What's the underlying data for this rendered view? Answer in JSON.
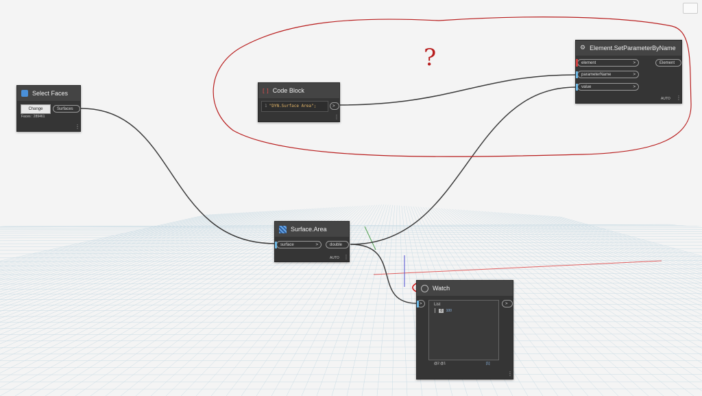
{
  "select_faces": {
    "title": "Select Faces",
    "change_label": "Change",
    "output_label": "Surfaces",
    "status": "Faces : 289461"
  },
  "code_block": {
    "title": "Code Block",
    "title_icon": "[ ]",
    "line_number": "1",
    "code": "\"DYN.Surface Area\";",
    "output_label": ">"
  },
  "set_param": {
    "title": "Element.SetParameterByName",
    "inputs": [
      "element",
      "parameterName",
      "value"
    ],
    "output_label": "Element",
    "lacing": "AUTO"
  },
  "surface_area": {
    "title": "Surface.Area",
    "input_label": "surface",
    "output_label": "double",
    "lacing": "AUTO"
  },
  "watch": {
    "title": "Watch",
    "list_label": "List",
    "item_index": "0",
    "item_value": "100",
    "footer_left": "@2 @1",
    "footer_right": "[1]",
    "output_label": ">"
  },
  "annotation": {
    "question_mark": "?"
  },
  "colors": {
    "node_bg": "#353535",
    "header_bg": "#444444",
    "wire": "#3a3a3a",
    "annotation_red": "#b81d1d",
    "port_blue": "#6cb7e4"
  }
}
